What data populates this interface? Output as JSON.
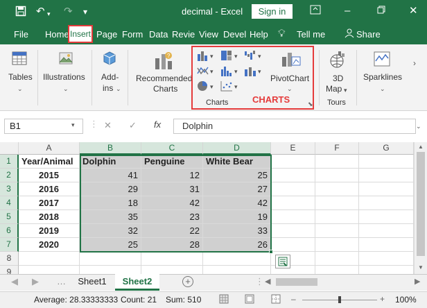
{
  "window": {
    "title": "decimal  -  Excel",
    "signin_label": "Sign in",
    "minimize_icon": "minimize-icon",
    "restore_icon": "restore-icon",
    "close_icon": "close-icon"
  },
  "tabs": [
    "File",
    "Home",
    "Insert",
    "Page",
    "Form",
    "Data",
    "Revie",
    "View",
    "Devel",
    "Help"
  ],
  "tellme": "Tell me",
  "share": "Share",
  "ribbon": {
    "tables": "Tables",
    "illustrations": "Illustrations",
    "addins_1": "Add-",
    "addins_2": "ins",
    "recommended_1": "Recommended",
    "recommended_2": "Charts",
    "pivotchart": "PivotChart",
    "charts_group": "Charts",
    "map_1": "3D",
    "map_2": "Map",
    "tours": "Tours",
    "sparklines": "Sparklines"
  },
  "annotation": "CHARTS",
  "namebox": "B1",
  "formula": "Dolphin",
  "columns": [
    "A",
    "B",
    "C",
    "D",
    "E",
    "F",
    "G"
  ],
  "rows": [
    "1",
    "2",
    "3",
    "4",
    "5",
    "6",
    "7",
    "8",
    "9"
  ],
  "table": {
    "header": [
      "Year/Animal",
      "Dolphin",
      "Penguine",
      "White Bear"
    ],
    "data": [
      [
        "2015",
        "41",
        "12",
        "25"
      ],
      [
        "2016",
        "29",
        "31",
        "27"
      ],
      [
        "2017",
        "18",
        "42",
        "42"
      ],
      [
        "2018",
        "35",
        "23",
        "19"
      ],
      [
        "2019",
        "32",
        "22",
        "33"
      ],
      [
        "2020",
        "25",
        "28",
        "26"
      ]
    ]
  },
  "sheets": [
    "Sheet1",
    "Sheet2"
  ],
  "status": {
    "average": "Average: 28.33333333",
    "count": "Count: 21",
    "sum": "Sum: 510",
    "zoom": "100%"
  },
  "colors": {
    "excel_green": "#217346",
    "highlight_red": "#e53b3b"
  }
}
